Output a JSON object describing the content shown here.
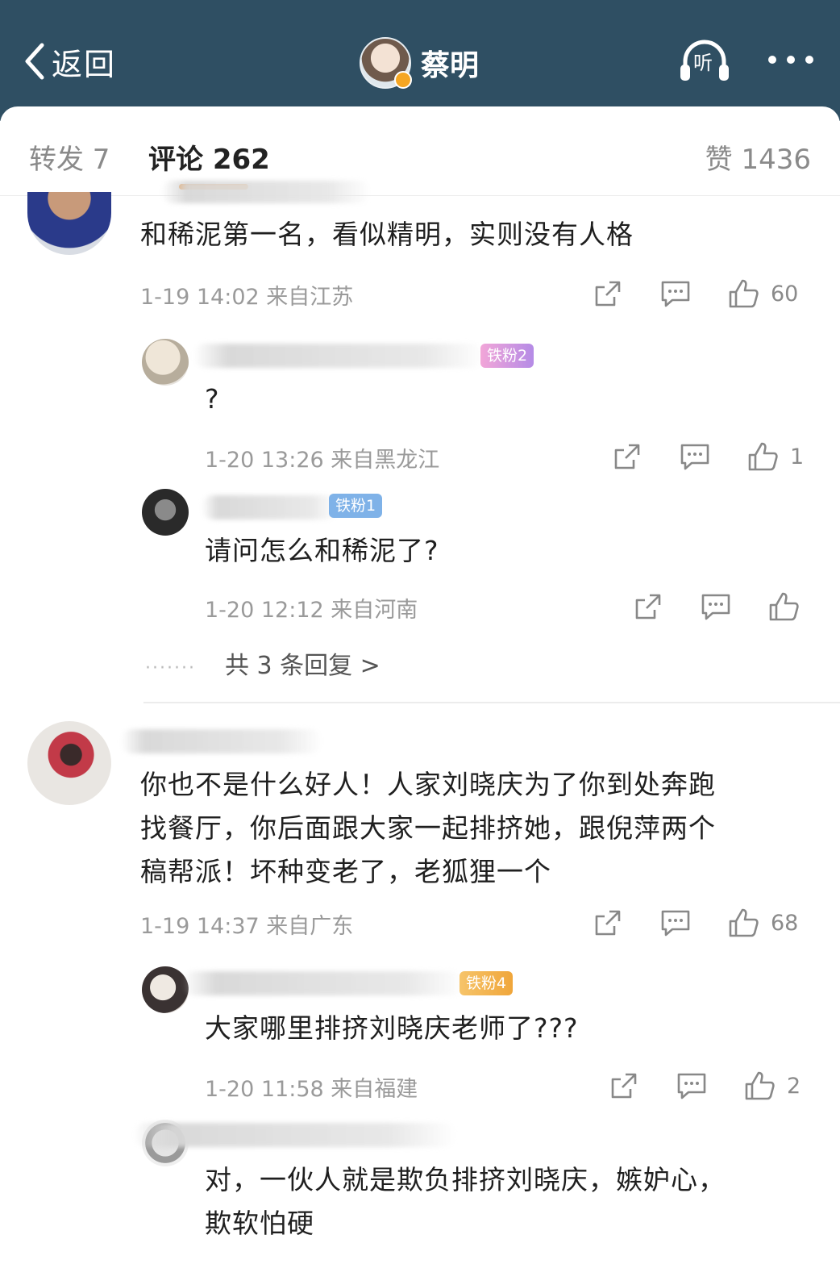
{
  "header": {
    "back_label": "返回",
    "user_name": "蔡明",
    "listen_label": "听",
    "colors": {
      "bar": "#2f4f63",
      "accent": "#f08a24"
    }
  },
  "tabs": {
    "reposts": "转发 7",
    "comments": "评论 262",
    "likes": "赞 1436"
  },
  "comments": [
    {
      "text": "和稀泥第一名，看似精明，实则没有人格",
      "meta": "1-19 14:02 来自江苏",
      "likes": "60",
      "replies": [
        {
          "badge": "铁粉2",
          "text": "?",
          "meta": "1-20 13:26 来自黑龙江",
          "likes": "1"
        },
        {
          "badge": "铁粉1",
          "text": "请问怎么和稀泥了?",
          "meta": "1-20 12:12 来自河南",
          "likes": ""
        }
      ],
      "more_replies": "共 3 条回复 >"
    },
    {
      "text_lines": [
        "你也不是什么好人！人家刘晓庆为了你到处奔跑",
        "找餐厅，你后面跟大家一起排挤她，跟倪萍两个",
        "稿帮派！坏种变老了，老狐狸一个"
      ],
      "meta": "1-19 14:37 来自广东",
      "likes": "68",
      "replies": [
        {
          "badge": "铁粉4",
          "text": "大家哪里排挤刘晓庆老师了???",
          "meta": "1-20 11:58 来自福建",
          "likes": "2"
        },
        {
          "text_lines": [
            "对，一伙人就是欺负排挤刘晓庆，嫉妒心，",
            "欺软怕硬"
          ]
        }
      ]
    }
  ],
  "icons": [
    "back-chevron-icon",
    "headphones-icon",
    "more-dots-icon",
    "share-icon",
    "comment-icon",
    "thumbs-up-icon"
  ]
}
